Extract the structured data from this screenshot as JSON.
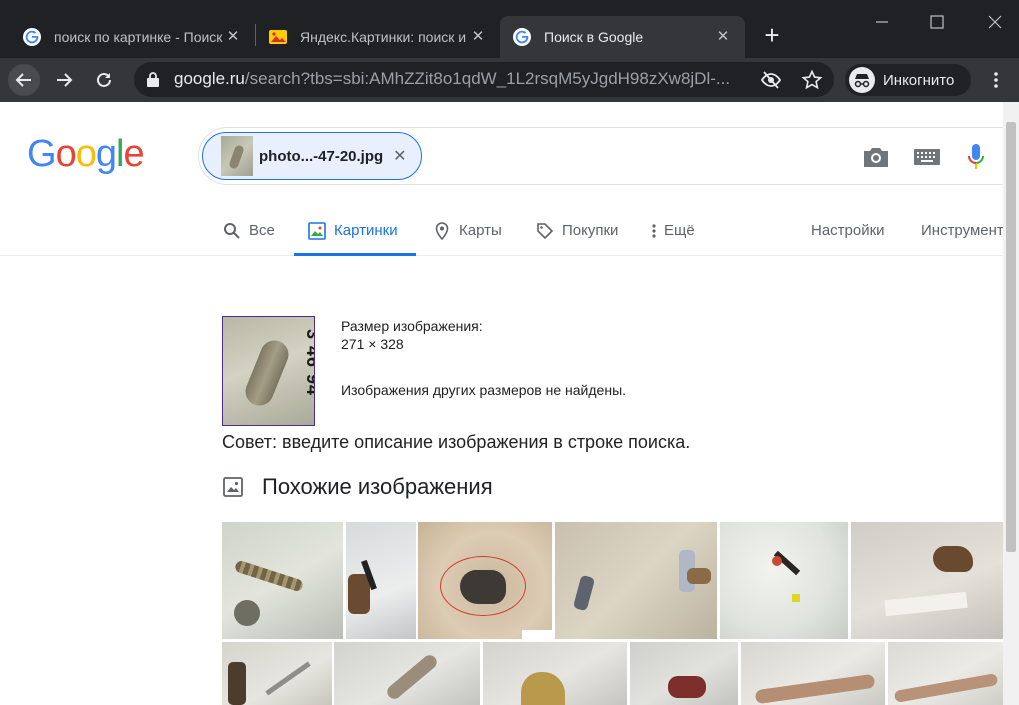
{
  "browser": {
    "tabs": [
      {
        "title": "поиск по картинке - Поиск в Google",
        "active": false
      },
      {
        "title": "Яндекс.Картинки: поиск изображений",
        "active": false
      },
      {
        "title": "Поиск в Google",
        "active": true
      }
    ],
    "url_main": "google.ru",
    "url_rest": "/search?tbs=sbi:AMhZZit8o1qdW_1L2rsqM5yJgdH98zXw8jDl-...",
    "incognito_label": "Инкогнито"
  },
  "search": {
    "chip_label": "photo...-47-20.jpg"
  },
  "nav": {
    "all": "Все",
    "images": "Картинки",
    "maps": "Карты",
    "shopping": "Покупки",
    "more": "Ещё",
    "settings": "Настройки",
    "tools": "Инструменты"
  },
  "result": {
    "size_label": "Размер изображения:",
    "size_value": "271 × 328",
    "no_other_sizes": "Изображения других размеров не найдены.",
    "tip": "Совет: введите описание изображения в строке поиска.",
    "thumb_text": "3 46 94",
    "similar_heading": "Похожие изображения"
  },
  "colors": {
    "accent": "#1a73e8",
    "chrome_bg": "#202124",
    "toolbar_bg": "#35363a"
  }
}
